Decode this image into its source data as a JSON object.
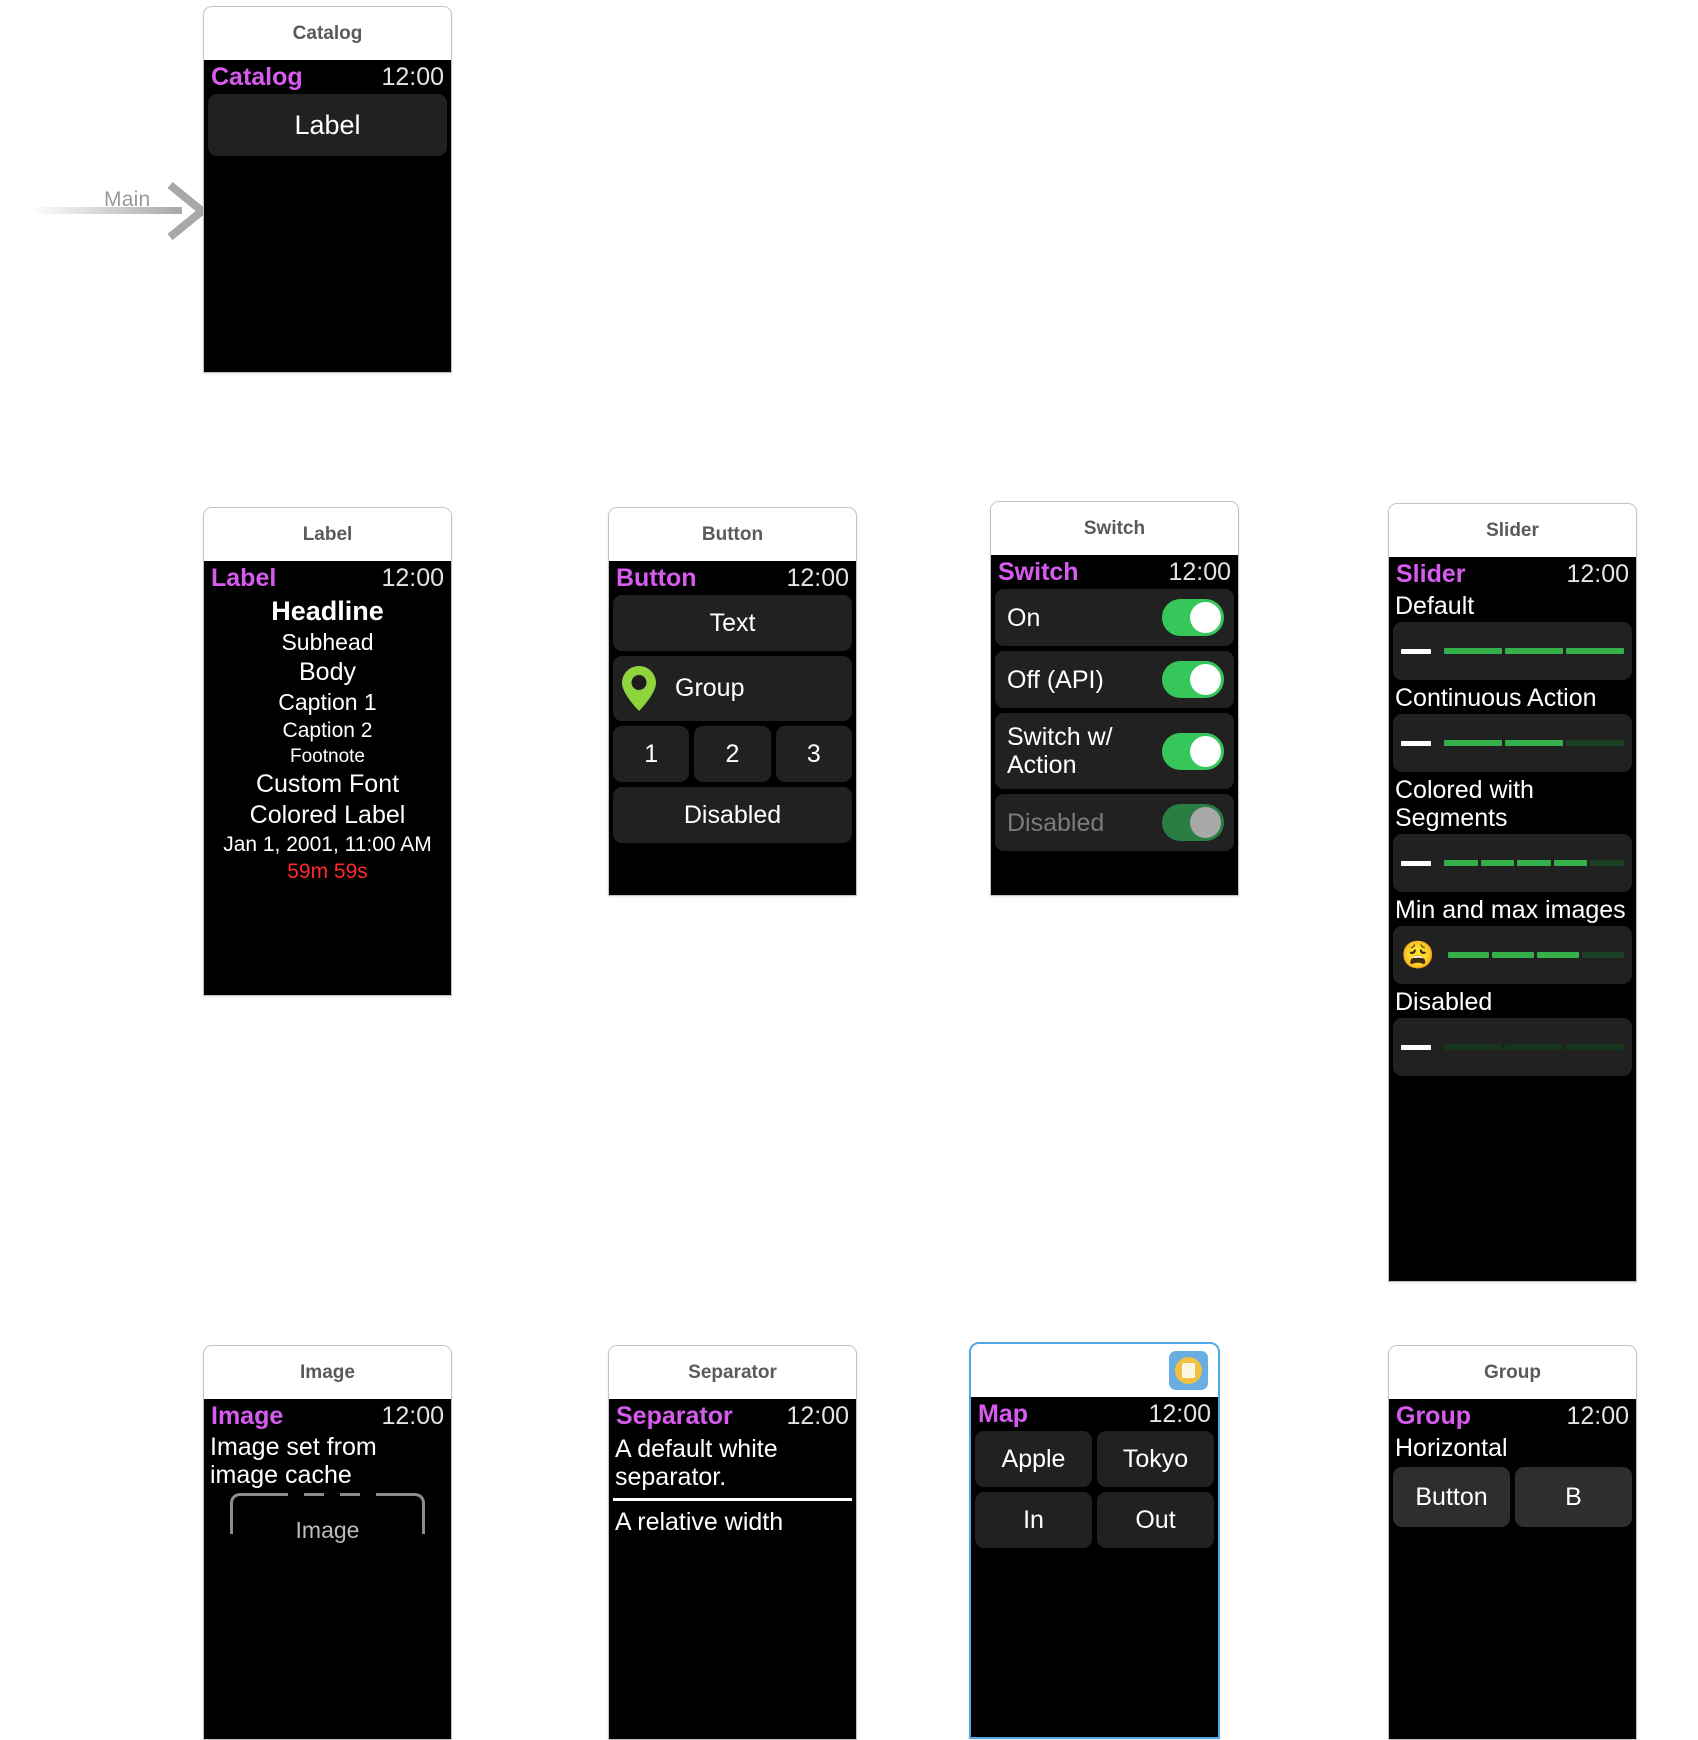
{
  "canvas": {
    "entry_point_label": "Main",
    "accent_purple": "#d85bf0",
    "scene_title_color": "#5a5a5a",
    "selection_blue": "#51a8e8",
    "switch_green": "#35c759",
    "timer_red": "#ff2a2a"
  },
  "scenes": {
    "catalog": {
      "scene_title": "Catalog",
      "status_title": "Catalog",
      "status_time": "12:00",
      "rows": [
        {
          "label": "Label"
        }
      ]
    },
    "label": {
      "scene_title": "Label",
      "status_title": "Label",
      "status_time": "12:00",
      "rows": [
        {
          "text": "Headline"
        },
        {
          "text": "Subhead"
        },
        {
          "text": "Body"
        },
        {
          "text": "Caption 1"
        },
        {
          "text": "Caption 2"
        },
        {
          "text": "Footnote"
        },
        {
          "text": "Custom Font"
        },
        {
          "text": "Colored Label"
        },
        {
          "text": "Jan 1, 2001, 11:00 AM"
        },
        {
          "text": "59m 59s"
        }
      ]
    },
    "button": {
      "scene_title": "Button",
      "status_title": "Button",
      "status_time": "12:00",
      "text_button": "Text",
      "group_button": "Group",
      "group_icon": "map-pin-icon",
      "number_buttons": [
        "1",
        "2",
        "3"
      ],
      "disabled_button": "Disabled"
    },
    "switch": {
      "scene_title": "Switch",
      "status_title": "Switch",
      "status_time": "12:00",
      "rows": [
        {
          "label": "On",
          "state": "on",
          "disabled": false
        },
        {
          "label": "Off (API)",
          "state": "on",
          "disabled": false
        },
        {
          "label": "Switch w/ Action",
          "state": "on",
          "disabled": false
        },
        {
          "label": "Disabled",
          "state": "off",
          "disabled": true
        }
      ]
    },
    "slider": {
      "scene_title": "Slider",
      "status_title": "Slider",
      "status_time": "12:00",
      "groups": [
        {
          "caption": "Default",
          "min_icon": "minus-icon",
          "segments": 3,
          "filled": 3,
          "dim": false
        },
        {
          "caption": "Continuous Action",
          "min_icon": "minus-icon",
          "segments": 3,
          "filled": 2,
          "dim": false
        },
        {
          "caption": "Colored with Segments",
          "min_icon": "minus-icon",
          "segments": 5,
          "filled": 4,
          "dim": false
        },
        {
          "caption": "Min and max images",
          "min_icon": "weary-face-emoji",
          "segments": 4,
          "filled": 3,
          "dim": false
        },
        {
          "caption": "Disabled",
          "min_icon": "minus-icon",
          "segments": 3,
          "filled": 0,
          "dim": true
        }
      ]
    },
    "image": {
      "scene_title": "Image",
      "status_title": "Image",
      "status_time": "12:00",
      "description": "Image set from image cache",
      "placeholder_label": "Image"
    },
    "separator": {
      "scene_title": "Separator",
      "status_title": "Separator",
      "status_time": "12:00",
      "line1": "A default white separator.",
      "line2": "A relative width"
    },
    "map": {
      "scene_title": "",
      "scene_badge_icon": "selected-scene-icon",
      "status_title": "Map",
      "status_time": "12:00",
      "buttons": [
        "Apple",
        "Tokyo",
        "In",
        "Out"
      ],
      "selected": true
    },
    "group": {
      "scene_title": "Group",
      "status_title": "Group",
      "status_time": "12:00",
      "caption": "Horizontal",
      "buttons": [
        "Button",
        "B"
      ]
    }
  }
}
